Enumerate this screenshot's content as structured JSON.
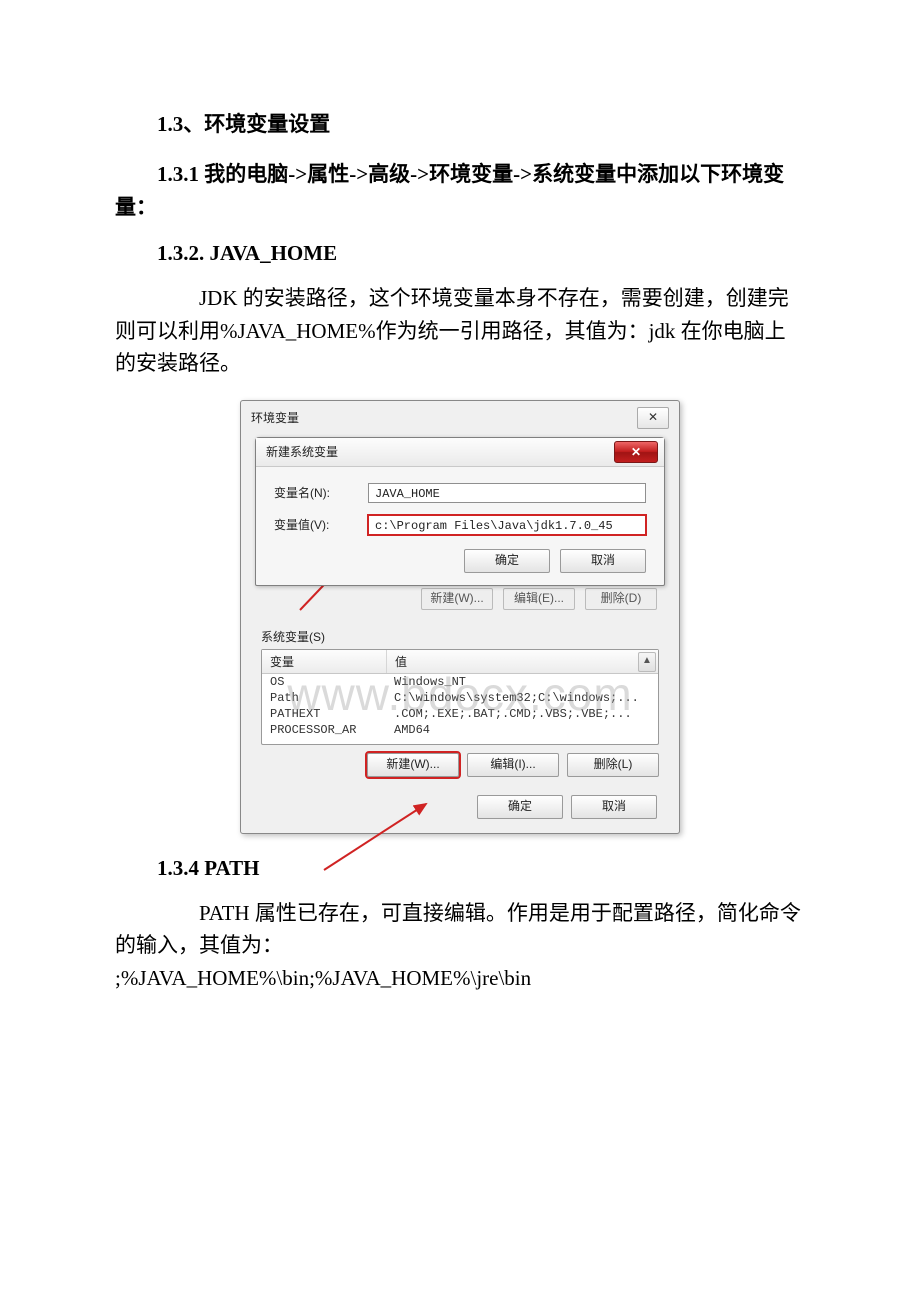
{
  "doc": {
    "h3": "1.3、环境变量设置",
    "h4a": "1.3.1   我的电脑->属性->高级->环境变量->系统变量中添加以下环境变量：",
    "h4b": "1.3.2.   JAVA_HOME",
    "p1": "JDK 的安装路径，这个环境变量本身不存在，需要创建，创建完则可以利用%JAVA_HOME%作为统一引用路径，其值为：jdk 在你电脑上的安装路径。",
    "h4c": "1.3.4 PATH",
    "p2a": "PATH 属性已存在，可直接编辑。作用是用于配置路径，简化命令的输入，其值为：",
    "p2b": ";%JAVA_HOME%\\bin;%JAVA_HOME%\\jre\\bin"
  },
  "dialog": {
    "outer_title": "环境变量",
    "outer_close": "✕",
    "inner_title": "新建系统变量",
    "inner_close": "✕",
    "name_label": "变量名(N):",
    "name_value": "JAVA_HOME",
    "value_label": "变量值(V):",
    "value_value": "c:\\Program Files\\Java\\jdk1.7.0_45",
    "ok": "确定",
    "cancel": "取消",
    "ghost_new": "新建(W)...",
    "ghost_edit": "编辑(E)...",
    "ghost_del": "删除(D)",
    "sys_label": "系统变量(S)",
    "col_var": "变量",
    "col_val": "值",
    "rows": [
      {
        "v": "OS",
        "d": "Windows_NT"
      },
      {
        "v": "Path",
        "d": "C:\\windows\\system32;C:\\windows;..."
      },
      {
        "v": "PATHEXT",
        "d": ".COM;.EXE;.BAT;.CMD;.VBS;.VBE;..."
      },
      {
        "v": "PROCESSOR_AR",
        "d": "AMD64"
      }
    ],
    "btn_new": "新建(W)...",
    "btn_edit": "编辑(I)...",
    "btn_del": "删除(L)",
    "bottom_ok": "确定",
    "bottom_cancel": "取消",
    "scroll_up": "▲",
    "watermark": "www.bdocx.com"
  }
}
